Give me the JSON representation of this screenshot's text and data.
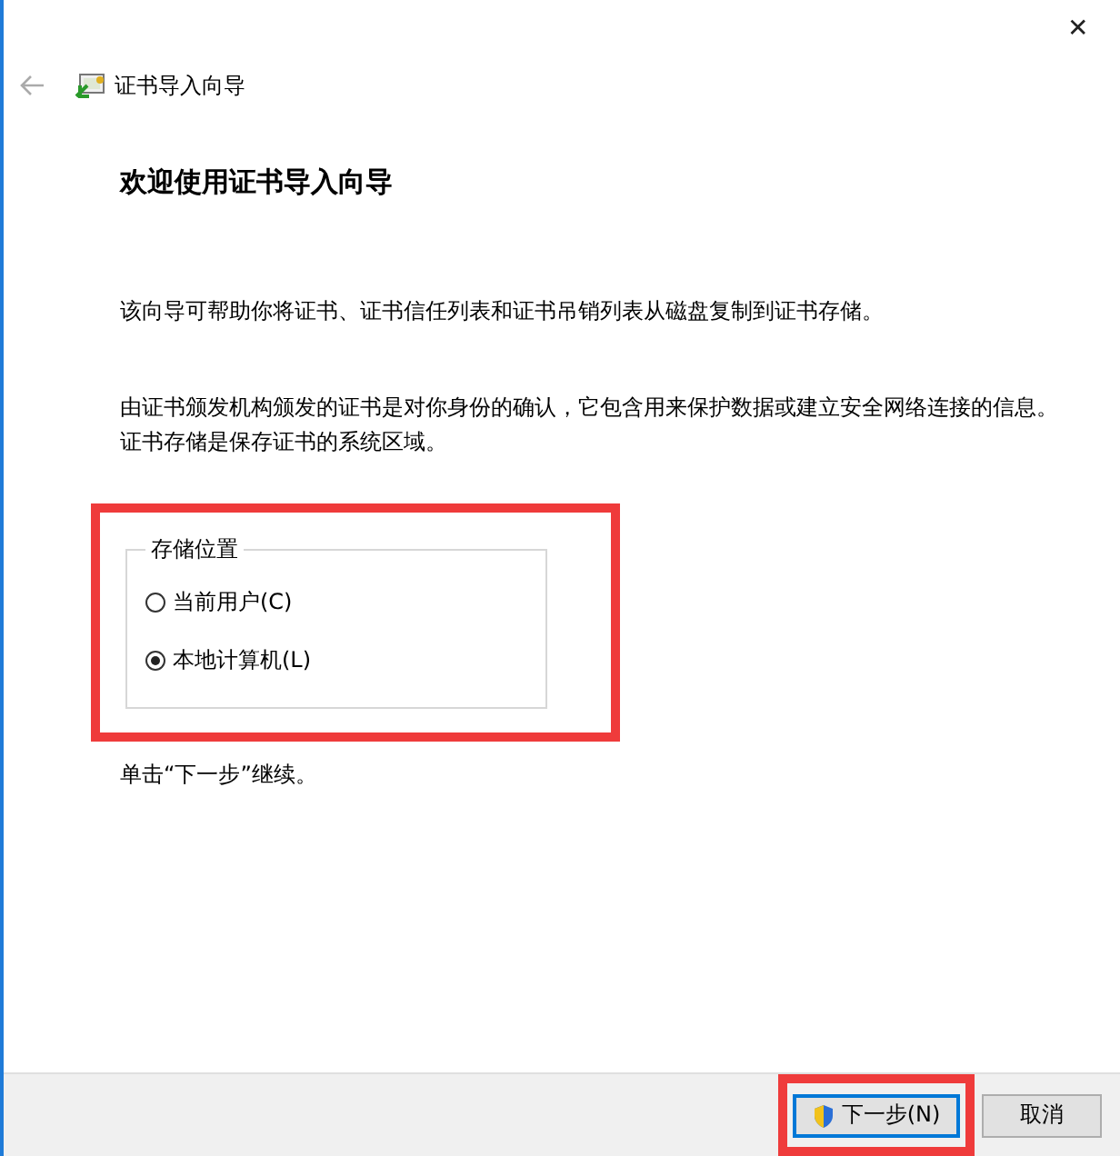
{
  "window": {
    "title": "证书导入向导",
    "close": "✕"
  },
  "heading": "欢迎使用证书导入向导",
  "paragraphs": [
    "该向导可帮助你将证书、证书信任列表和证书吊销列表从磁盘复制到证书存储。",
    "由证书颁发机构颁发的证书是对你身份的确认，它包含用来保护数据或建立安全网络连接的信息。证书存储是保存证书的系统区域。"
  ],
  "store_location": {
    "label": "存储位置",
    "options": [
      {
        "label": "当前用户(C)",
        "selected": false
      },
      {
        "label": "本地计算机(L)",
        "selected": true
      }
    ]
  },
  "hint": "单击“下一步”继续。",
  "buttons": [
    {
      "label": "下一步(N)",
      "kind": "next"
    },
    {
      "label": "取消",
      "kind": "cancel"
    }
  ]
}
